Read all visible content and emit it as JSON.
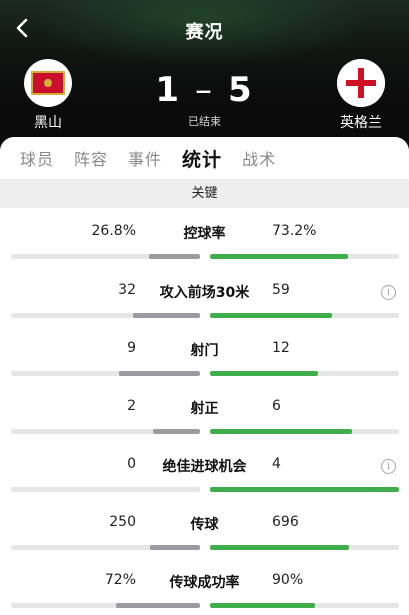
{
  "header": {
    "title": "赛况",
    "home_team": "黑山",
    "away_team": "英格兰",
    "home_score": "1",
    "separator": "–",
    "away_score": "5",
    "status": "已结束"
  },
  "tabs": [
    {
      "label": "球员",
      "active": false
    },
    {
      "label": "阵容",
      "active": false
    },
    {
      "label": "事件",
      "active": false
    },
    {
      "label": "统计",
      "active": true
    },
    {
      "label": "战术",
      "active": false
    }
  ],
  "section_title": "关键",
  "stats": [
    {
      "label": "控球率",
      "home": "26.8%",
      "away": "73.2%",
      "home_fraction": 0.268,
      "away_fraction": 0.732,
      "info": false
    },
    {
      "label": "攻入前场30米",
      "home": "32",
      "away": "59",
      "home_fraction": 0.352,
      "away_fraction": 0.648,
      "info": true
    },
    {
      "label": "射门",
      "home": "9",
      "away": "12",
      "home_fraction": 0.429,
      "away_fraction": 0.571,
      "info": false
    },
    {
      "label": "射正",
      "home": "2",
      "away": "6",
      "home_fraction": 0.25,
      "away_fraction": 0.75,
      "info": false
    },
    {
      "label": "绝佳进球机会",
      "home": "0",
      "away": "4",
      "home_fraction": 0.0,
      "away_fraction": 1.0,
      "info": true
    },
    {
      "label": "传球",
      "home": "250",
      "away": "696",
      "home_fraction": 0.264,
      "away_fraction": 0.736,
      "info": false
    },
    {
      "label": "传球成功率",
      "home": "72%",
      "away": "90%",
      "home_fraction": 0.444,
      "away_fraction": 0.556,
      "info": false
    }
  ],
  "colors": {
    "home_bar": "#9a9aa0",
    "away_bar": "#3fae4a",
    "track": "#e6e6e6"
  },
  "icons": {
    "back": "chevron-left-icon",
    "info": "info-icon"
  }
}
